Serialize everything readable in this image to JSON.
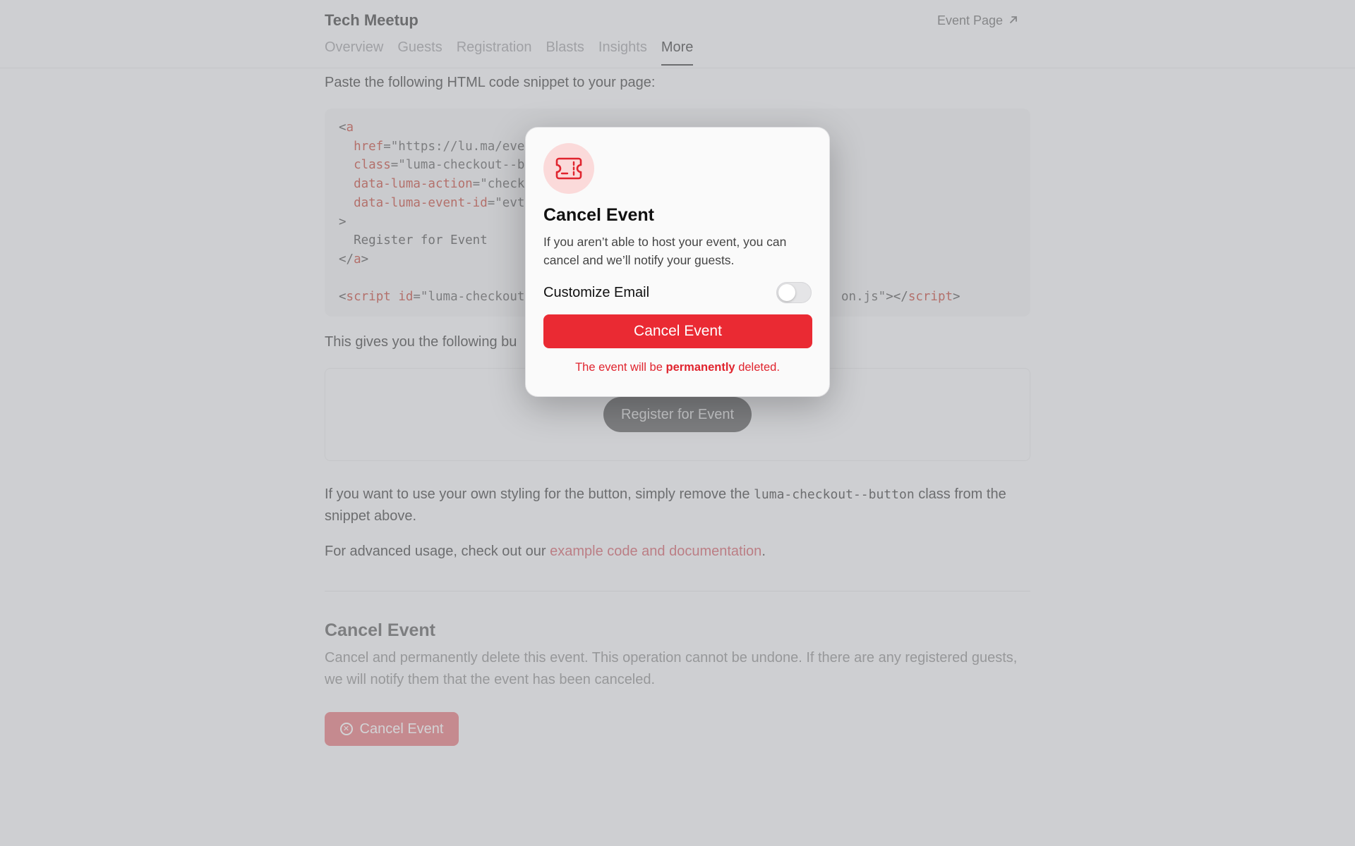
{
  "header": {
    "title": "Tech Meetup",
    "event_page_label": "Event Page"
  },
  "tabs": [
    {
      "label": "Overview"
    },
    {
      "label": "Guests"
    },
    {
      "label": "Registration"
    },
    {
      "label": "Blasts"
    },
    {
      "label": "Insights"
    },
    {
      "label": "More",
      "active": true
    }
  ],
  "embed": {
    "intro": "Paste the following HTML code snippet to your page:",
    "code": {
      "l1_open": "<",
      "l1_tag": "a",
      "l2_attr": "href",
      "l2_val": "=\"https://lu.ma/eve",
      "l3_attr": "class",
      "l3_val": "=\"luma-checkout--b",
      "l4_attr": "data-luma-action",
      "l4_val": "=\"check",
      "l5_attr": "data-luma-event-id",
      "l5_val": "=\"evt",
      "l6": ">",
      "l7": "Register for Event",
      "l8_open": "</",
      "l8_tag": "a",
      "l8_close": ">",
      "l10_open": "<",
      "l10_tag": "script",
      "l10_attr": "id",
      "l10_val": "=\"luma-checkout",
      "l10_tail_val": "on.js\"",
      "l10_tail_open": "></",
      "l10_tail_tag": "script",
      "l10_tail_close": ">"
    },
    "result_intro": "This gives you the following bu",
    "preview_button": "Register for Event",
    "styling_text_1": "If you want to use your own styling for the button, simply remove the ",
    "styling_code": "luma-checkout--button",
    "styling_text_2": " class from the snippet above.",
    "advanced_text": "For advanced usage, check out our ",
    "advanced_link": "example code and documentation",
    "advanced_end": "."
  },
  "cancel_section": {
    "title": "Cancel Event",
    "description": "Cancel and permanently delete this event. This operation cannot be undone. If there are any registered guests, we will notify them that the event has been canceled.",
    "button_label": "Cancel Event"
  },
  "modal": {
    "icon": "ticket-icon",
    "title": "Cancel Event",
    "description": "If you aren’t able to host your event, you can cancel and we’ll notify your guests.",
    "customize_email_label": "Customize Email",
    "customize_email_on": false,
    "confirm_label": "Cancel Event",
    "warning_pre": "The event will be ",
    "warning_bold": "permanently",
    "warning_post": " deleted."
  },
  "colors": {
    "danger": "#ea2a33",
    "danger_soft": "#fbdada",
    "link": "#d0555e"
  }
}
